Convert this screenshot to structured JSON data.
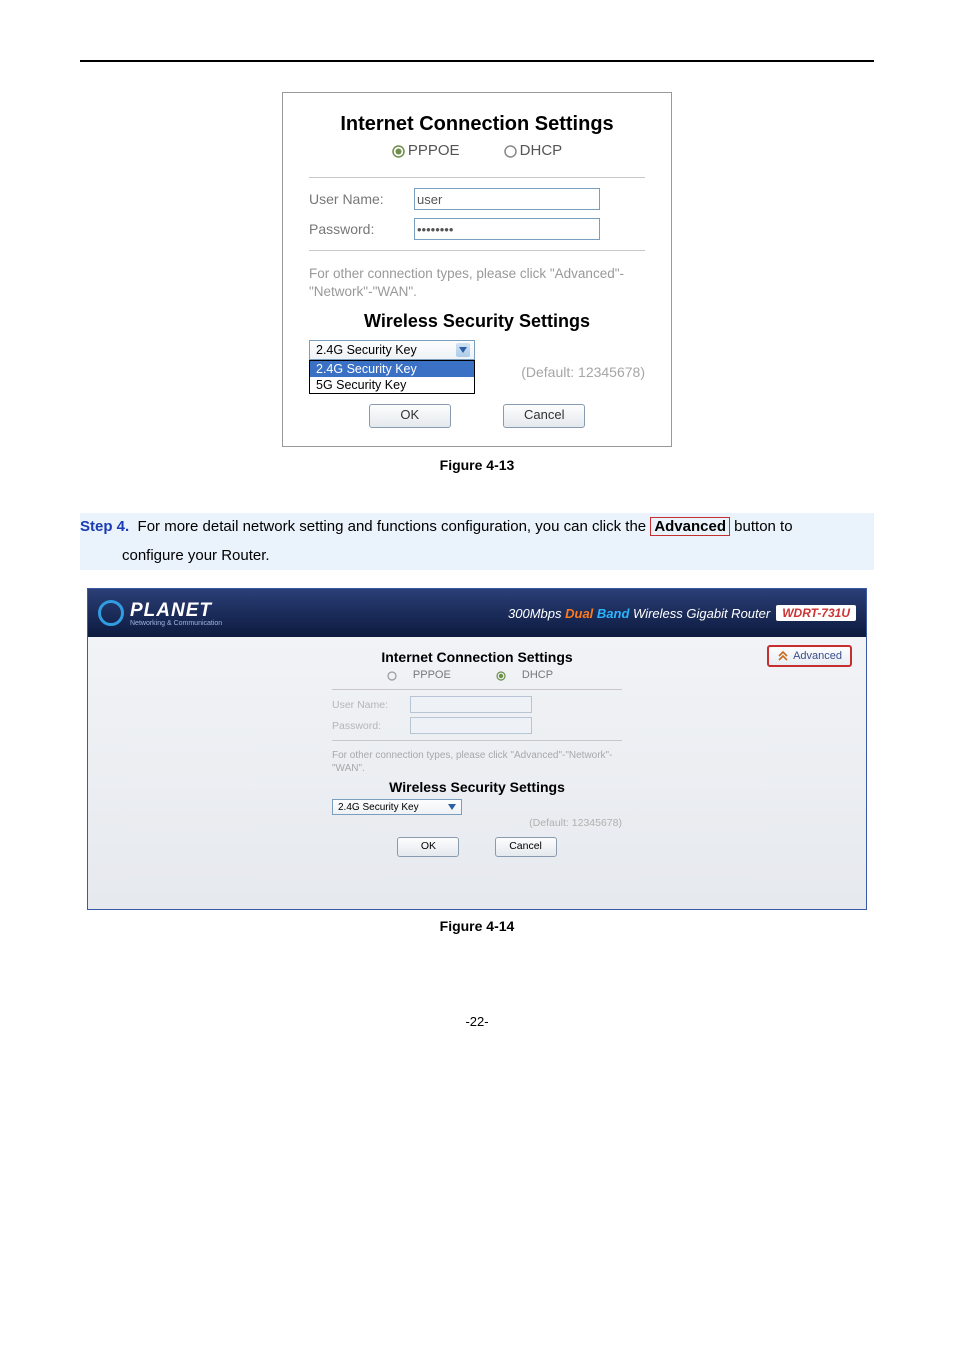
{
  "panel1": {
    "heading_conn": "Internet Connection Settings",
    "radio_pppoe": "PPPOE",
    "radio_dhcp": "DHCP",
    "lbl_username": "User Name:",
    "val_username": "user",
    "lbl_password": "Password:",
    "val_password": "••••••••",
    "help_text": "For other connection types, please click \"Advanced\"-\"Network\"-\"WAN\".",
    "heading_wireless": "Wireless Security Settings",
    "select_selected": "2.4G Security Key",
    "select_options": [
      "2.4G Security Key",
      "5G Security Key"
    ],
    "default_label": "(Default: 12345678)",
    "btn_ok": "OK",
    "btn_cancel": "Cancel"
  },
  "caption1": "Figure 4-13",
  "step": {
    "label": "Step 4.",
    "text_before_adv": "For more detail network setting and functions configuration, you can click the ",
    "advanced_word": "Advanced",
    "text_after_adv": " button to",
    "line2": "configure your Router."
  },
  "router": {
    "brand": "PLANET",
    "brand_tag": "Networking & Communication",
    "title_300": "300Mbps",
    "title_dual": "Dual",
    "title_band": "Band",
    "title_rest": "Wireless Gigabit Router",
    "model": "WDRT-731U",
    "adv_btn": "Advanced",
    "inner": {
      "heading_conn": "Internet Connection Settings",
      "radio_pppoe": "PPPOE",
      "radio_dhcp": "DHCP",
      "lbl_username": "User Name:",
      "lbl_password": "Password:",
      "help_text": "For other connection types, please click \"Advanced\"-\"Network\"-\"WAN\".",
      "heading_wireless": "Wireless Security Settings",
      "select_selected": "2.4G Security Key",
      "default_label": "(Default: 12345678)",
      "btn_ok": "OK",
      "btn_cancel": "Cancel"
    }
  },
  "caption2": "Figure 4-14",
  "footer": "-22-"
}
